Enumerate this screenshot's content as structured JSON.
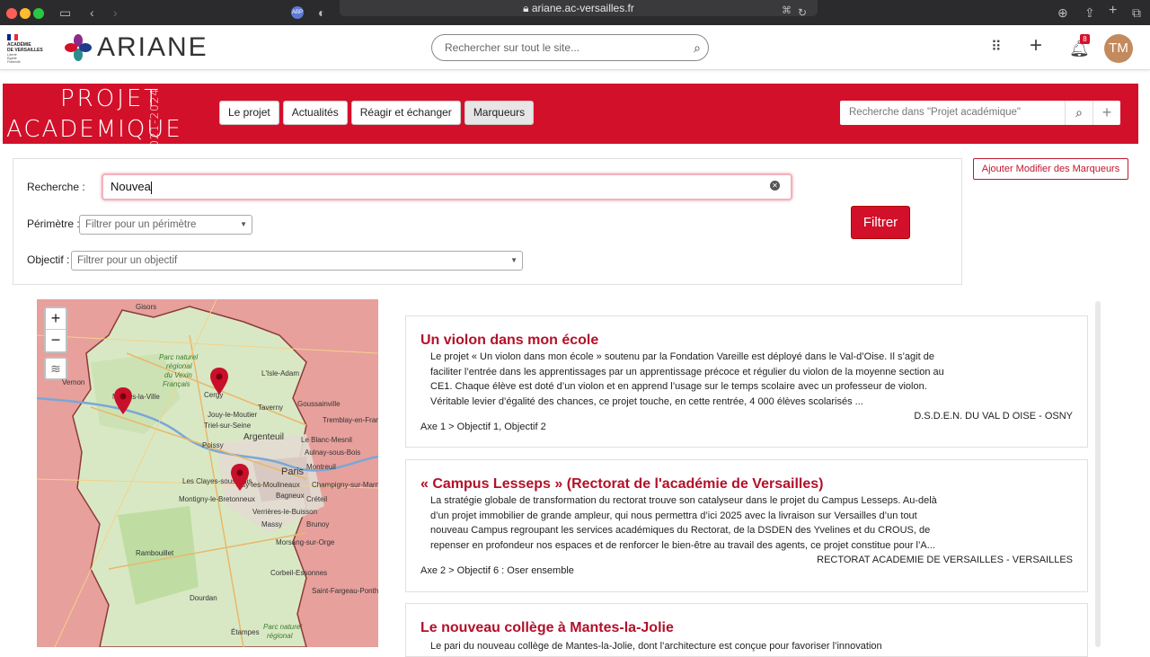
{
  "browser": {
    "url": "ariane.ac-versailles.fr",
    "adblock_label": "ABP"
  },
  "header": {
    "institution": [
      "ACADÉMIE",
      "DE VERSAILLES",
      "Liberté",
      "Égalité",
      "Fraternité"
    ],
    "logo_text": "ARIANE",
    "search_placeholder": "Rechercher sur tout le site...",
    "notification_count": "8",
    "avatar_initials": "TM"
  },
  "banner": {
    "title_line1": "PROJET",
    "title_line2": "ACADEMIQUE",
    "years": "2021-2024",
    "tabs": [
      {
        "label": "Le projet"
      },
      {
        "label": "Actualités"
      },
      {
        "label": "Réagir et échanger"
      },
      {
        "label": "Marqueurs"
      }
    ],
    "search_placeholder": "Recherche dans \"Projet académique\""
  },
  "filters": {
    "recherche_label": "Recherche :",
    "recherche_value": "Nouvea",
    "perimetre_label": "Périmètre :",
    "perimetre_placeholder": "Filtrer pour un périmètre",
    "objectif_label": "Objectif :",
    "objectif_placeholder": "Filtrer pour un objectif",
    "filter_button": "Filtrer",
    "add_marker_button": "Ajouter Modifier des Marqueurs"
  },
  "map": {
    "zoom_in": "+",
    "zoom_out": "−",
    "labels": [
      "Gisors",
      "Parc naturel",
      "régional",
      "du Vexin",
      "Français",
      "L'Isle-Adam",
      "Vernon",
      "Cergy",
      "Mantes-la-Ville",
      "Jouy-le-Moutier",
      "Taverny",
      "Goussainville",
      "Triel-sur-Seine",
      "Tremblay-en-France",
      "Poissy",
      "Argenteuil",
      "Le Blanc-Mesnil",
      "Aulnay-sous-Bois",
      "Montreuil",
      "Paris",
      "Les Clayes-sous-Bois",
      "Issy-les-Moulineaux",
      "Montigny-le-Bretonneux",
      "Bagneux",
      "Verrières-le-Buisson",
      "Créteil",
      "Champigny-sur-Marne",
      "Brunoy",
      "Massy",
      "Rambouillet",
      "Morsang-sur-Orge",
      "Corbeil-Essonnes",
      "Saint-Fargeau-Ponthierry",
      "Dourdan",
      "Étampes",
      "Parc naturel",
      "régional"
    ]
  },
  "results": [
    {
      "title": "Un violon dans mon école",
      "description": "Le projet « Un violon dans mon école » soutenu par la Fondation Vareille est déployé dans le Val-d’Oise. Il s’agit de faciliter l’entrée dans les apprentissages par un apprentissage précoce et régulier du violon de la moyenne section au CE1. Chaque élève est doté d’un violon et en apprend l’usage sur le temps scolaire avec un professeur de violon. Véritable levier d’égalité des chances, ce projet touche, en cette rentrée, 4 000 élèves scolarisés ...",
      "author": "D.S.D.E.N. DU VAL D OISE - OSNY",
      "axe": "Axe 1 > Objectif 1, Objectif 2"
    },
    {
      "title": "« Campus Lesseps » (Rectorat de l'académie de Versailles)",
      "description": "La stratégie globale de transformation du rectorat trouve son catalyseur dans le projet du Campus Lesseps. Au-delà d’un projet immobilier de grande ampleur, qui nous permettra d’ici 2025 avec la livraison sur Versailles d’un tout nouveau Campus regroupant les services académiques du Rectorat, de la DSDEN des Yvelines et du CROUS, de repenser en profondeur nos espaces et de renforcer le bien-être au travail des agents, ce projet constitue pour l’A...",
      "author": "RECTORAT ACADEMIE DE VERSAILLES - VERSAILLES",
      "axe": "Axe 2 > Objectif 6 : Oser ensemble"
    },
    {
      "title": "Le nouveau collège à Mantes-la-Jolie",
      "description": "Le pari du nouveau collège de Mantes-la-Jolie, dont l’architecture est conçue pour favoriser l’innovation"
    }
  ],
  "colors": {
    "brand_red": "#d3102a",
    "title_red": "#b3102a"
  }
}
